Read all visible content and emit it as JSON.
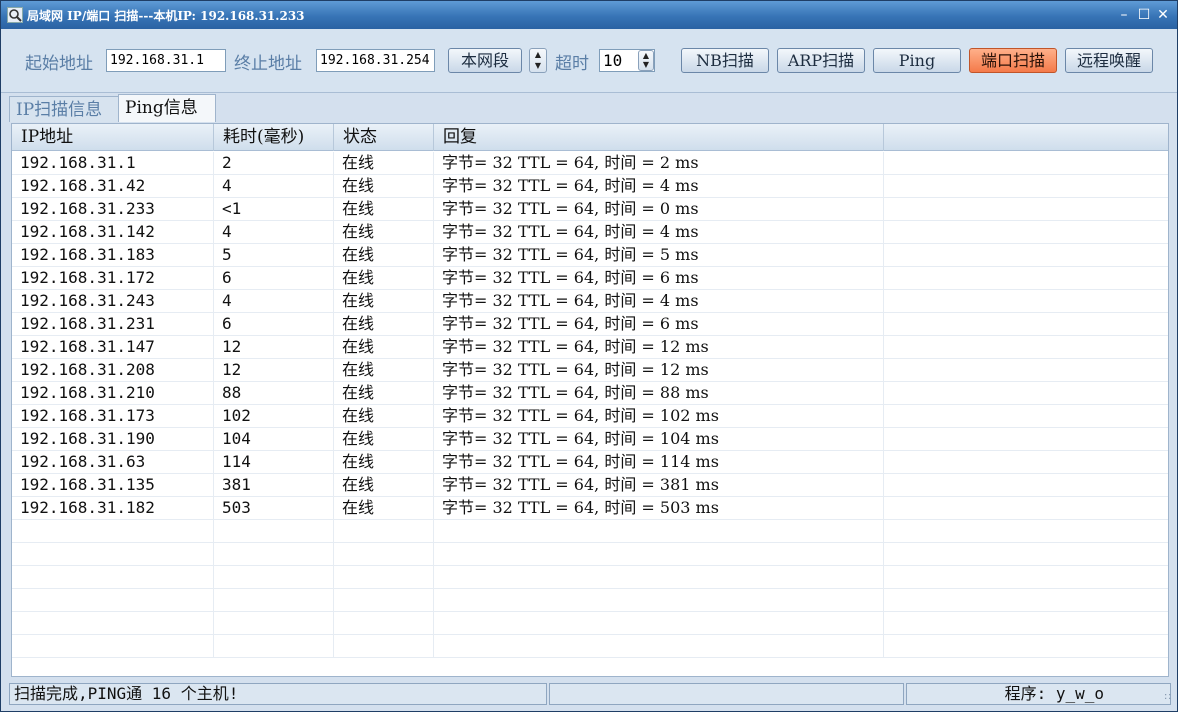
{
  "window": {
    "title": "局域网 IP/端口 扫描---本机IP: 192.168.31.233"
  },
  "toolbar": {
    "start_label": "起始地址",
    "start_value": "192.168.31.1",
    "end_label": "终止地址",
    "end_value": "192.168.31.254",
    "segment_button": "本网段",
    "timeout_label": "超时",
    "timeout_value": "10",
    "nb_button": "NB扫描",
    "arp_button": "ARP扫描",
    "ping_button": "Ping",
    "port_button": "端口扫描",
    "wake_button": "远程唤醒"
  },
  "tabs": [
    {
      "label": "IP扫描信息",
      "active": false
    },
    {
      "label": "Ping信息",
      "active": true
    }
  ],
  "table": {
    "columns": [
      "IP地址",
      "耗时(毫秒)",
      "状态",
      "回复"
    ],
    "rows": [
      [
        "192.168.31.1",
        "2",
        "在线",
        "字节= 32 TTL = 64, 时间 = 2 ms"
      ],
      [
        "192.168.31.42",
        "4",
        "在线",
        "字节= 32 TTL = 64, 时间 = 4 ms"
      ],
      [
        "192.168.31.233",
        "<1",
        "在线",
        "字节= 32 TTL = 64, 时间 = 0 ms"
      ],
      [
        "192.168.31.142",
        "4",
        "在线",
        "字节= 32 TTL = 64, 时间 = 4 ms"
      ],
      [
        "192.168.31.183",
        "5",
        "在线",
        "字节= 32 TTL = 64, 时间 = 5 ms"
      ],
      [
        "192.168.31.172",
        "6",
        "在线",
        "字节= 32 TTL = 64, 时间 = 6 ms"
      ],
      [
        "192.168.31.243",
        "4",
        "在线",
        "字节= 32 TTL = 64, 时间 = 4 ms"
      ],
      [
        "192.168.31.231",
        "6",
        "在线",
        "字节= 32 TTL = 64, 时间 = 6 ms"
      ],
      [
        "192.168.31.147",
        "12",
        "在线",
        "字节= 32 TTL = 64, 时间 = 12 ms"
      ],
      [
        "192.168.31.208",
        "12",
        "在线",
        "字节= 32 TTL = 64, 时间 = 12 ms"
      ],
      [
        "192.168.31.210",
        "88",
        "在线",
        "字节= 32 TTL = 64, 时间 = 88 ms"
      ],
      [
        "192.168.31.173",
        "102",
        "在线",
        "字节= 32 TTL = 64, 时间 = 102 ms"
      ],
      [
        "192.168.31.190",
        "104",
        "在线",
        "字节= 32 TTL = 64, 时间 = 104 ms"
      ],
      [
        "192.168.31.63",
        "114",
        "在线",
        "字节= 32 TTL = 64, 时间 = 114 ms"
      ],
      [
        "192.168.31.135",
        "381",
        "在线",
        "字节= 32 TTL = 64, 时间 = 381 ms"
      ],
      [
        "192.168.31.182",
        "503",
        "在线",
        "字节= 32 TTL = 64, 时间 = 503 ms"
      ]
    ]
  },
  "status": {
    "message": "扫描完成,PING通 16 个主机!",
    "middle": "",
    "author": "程序: y_w_o"
  },
  "colors": {
    "accent_button": "#f47a4a",
    "title_bar": "#3774b6"
  }
}
